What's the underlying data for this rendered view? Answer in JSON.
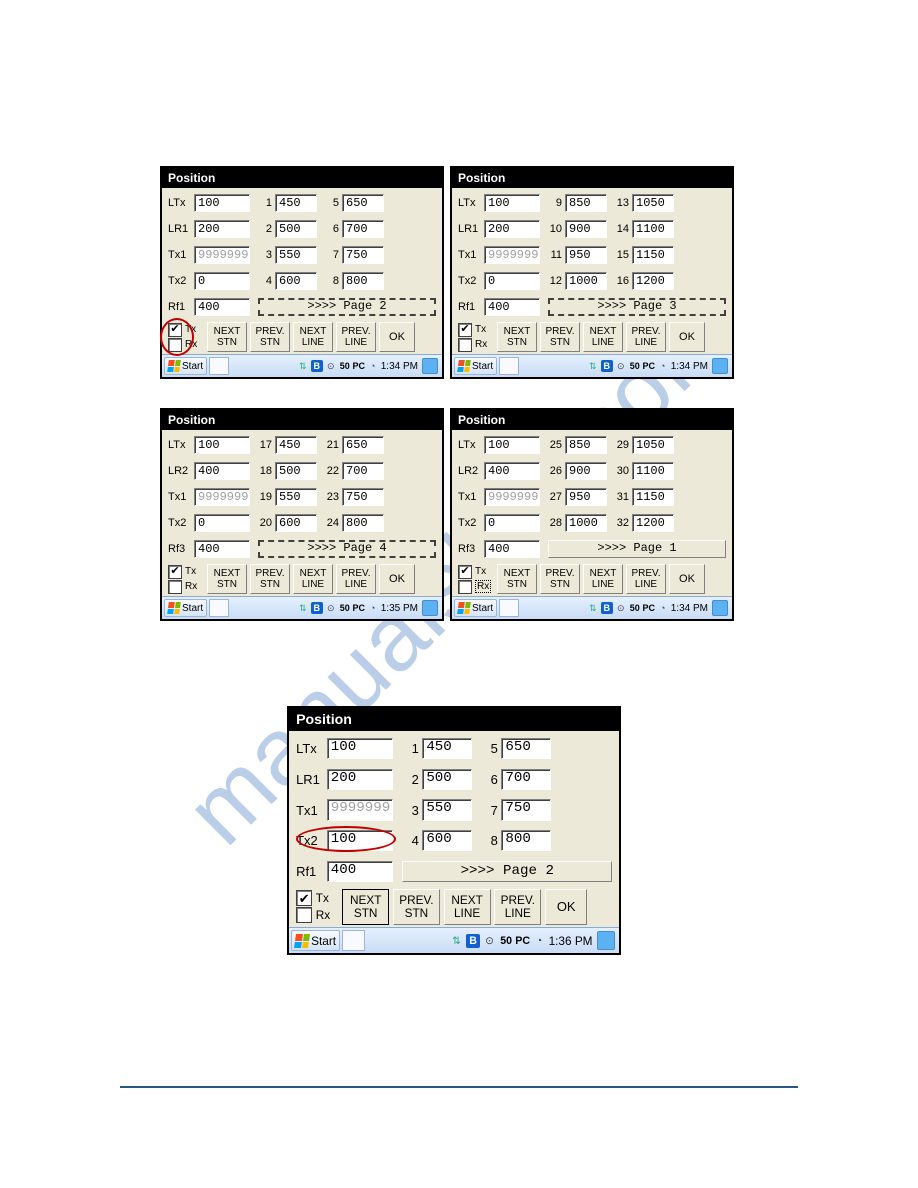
{
  "panels": [
    {
      "title": "Position",
      "leftRows": [
        {
          "label": "LTx",
          "value": "100"
        },
        {
          "label": "LR1",
          "value": "200"
        },
        {
          "label": "Tx1",
          "value": "9999999",
          "disabled": true
        },
        {
          "label": "Tx2",
          "value": "0"
        },
        {
          "label": "Rf1",
          "value": "400"
        }
      ],
      "gridCols": [
        [
          {
            "n": "1",
            "v": "450"
          },
          {
            "n": "2",
            "v": "500"
          },
          {
            "n": "3",
            "v": "550"
          },
          {
            "n": "4",
            "v": "600"
          }
        ],
        [
          {
            "n": "5",
            "v": "650"
          },
          {
            "n": "6",
            "v": "700"
          },
          {
            "n": "7",
            "v": "750"
          },
          {
            "n": "8",
            "v": "800"
          }
        ]
      ],
      "pageLabel": ">>>>  Page  2",
      "pageDashed": true,
      "tx": true,
      "rx": false,
      "buttons": [
        "NEXT\nSTN",
        "PREV.\nSTN",
        "NEXT\nLINE",
        "PREV.\nLINE"
      ],
      "okLabel": "OK",
      "time": "1:34 PM",
      "annot": "circle-left"
    },
    {
      "title": "Position",
      "leftRows": [
        {
          "label": "LTx",
          "value": "100"
        },
        {
          "label": "LR1",
          "value": "200"
        },
        {
          "label": "Tx1",
          "value": "9999999",
          "disabled": true
        },
        {
          "label": "Tx2",
          "value": "0"
        },
        {
          "label": "Rf1",
          "value": "400"
        }
      ],
      "gridCols": [
        [
          {
            "n": "9",
            "v": "850"
          },
          {
            "n": "10",
            "v": "900"
          },
          {
            "n": "11",
            "v": "950"
          },
          {
            "n": "12",
            "v": "1000"
          }
        ],
        [
          {
            "n": "13",
            "v": "1050"
          },
          {
            "n": "14",
            "v": "1100"
          },
          {
            "n": "15",
            "v": "1150"
          },
          {
            "n": "16",
            "v": "1200"
          }
        ]
      ],
      "pageLabel": ">>>>  Page  3",
      "pageDashed": true,
      "tx": true,
      "rx": false,
      "buttons": [
        "NEXT\nSTN",
        "PREV.\nSTN",
        "NEXT\nLINE",
        "PREV.\nLINE"
      ],
      "okLabel": "OK",
      "time": "1:34 PM"
    },
    {
      "title": "Position",
      "leftRows": [
        {
          "label": "LTx",
          "value": "100"
        },
        {
          "label": "LR2",
          "value": "400"
        },
        {
          "label": "Tx1",
          "value": "9999999",
          "disabled": true
        },
        {
          "label": "Tx2",
          "value": "0"
        },
        {
          "label": "Rf3",
          "value": "400"
        }
      ],
      "gridCols": [
        [
          {
            "n": "17",
            "v": "450"
          },
          {
            "n": "18",
            "v": "500"
          },
          {
            "n": "19",
            "v": "550"
          },
          {
            "n": "20",
            "v": "600"
          }
        ],
        [
          {
            "n": "21",
            "v": "650"
          },
          {
            "n": "22",
            "v": "700"
          },
          {
            "n": "23",
            "v": "750"
          },
          {
            "n": "24",
            "v": "800"
          }
        ]
      ],
      "pageLabel": ">>>>  Page  4",
      "pageDashed": true,
      "tx": true,
      "rx": false,
      "buttons": [
        "NEXT\nSTN",
        "PREV.\nSTN",
        "NEXT\nLINE",
        "PREV.\nLINE"
      ],
      "okLabel": "OK",
      "time": "1:35 PM"
    },
    {
      "title": "Position",
      "leftRows": [
        {
          "label": "LTx",
          "value": "100"
        },
        {
          "label": "LR2",
          "value": "400"
        },
        {
          "label": "Tx1",
          "value": "9999999",
          "disabled": true
        },
        {
          "label": "Tx2",
          "value": "0"
        },
        {
          "label": "Rf3",
          "value": "400"
        }
      ],
      "gridCols": [
        [
          {
            "n": "25",
            "v": "850"
          },
          {
            "n": "26",
            "v": "900"
          },
          {
            "n": "27",
            "v": "950"
          },
          {
            "n": "28",
            "v": "1000"
          }
        ],
        [
          {
            "n": "29",
            "v": "1050"
          },
          {
            "n": "30",
            "v": "1100"
          },
          {
            "n": "31",
            "v": "1150"
          },
          {
            "n": "32",
            "v": "1200"
          }
        ]
      ],
      "pageLabel": ">>>>  Page  1",
      "pageDashed": false,
      "tx": true,
      "rx": false,
      "rxBox": true,
      "buttons": [
        "NEXT\nSTN",
        "PREV.\nSTN",
        "NEXT\nLINE",
        "PREV.\nLINE"
      ],
      "okLabel": "OK",
      "time": "1:34 PM"
    },
    {
      "title": "Position",
      "leftRows": [
        {
          "label": "LTx",
          "value": "100"
        },
        {
          "label": "LR1",
          "value": "200"
        },
        {
          "label": "Tx1",
          "value": "9999999",
          "disabled": true
        },
        {
          "label": "Tx2",
          "value": "100"
        },
        {
          "label": "Rf1",
          "value": "400"
        }
      ],
      "gridCols": [
        [
          {
            "n": "1",
            "v": "450"
          },
          {
            "n": "2",
            "v": "500"
          },
          {
            "n": "3",
            "v": "550"
          },
          {
            "n": "4",
            "v": "600"
          }
        ],
        [
          {
            "n": "5",
            "v": "650"
          },
          {
            "n": "6",
            "v": "700"
          },
          {
            "n": "7",
            "v": "750"
          },
          {
            "n": "8",
            "v": "800"
          }
        ]
      ],
      "pageLabel": ">>>>  Page  2",
      "pageDashed": false,
      "tx": true,
      "rx": false,
      "buttons": [
        "NEXT\nSTN",
        "PREV.\nSTN",
        "NEXT\nLINE",
        "PREV.\nLINE"
      ],
      "hlButton": 0,
      "okLabel": "OK",
      "time": "1:36 PM",
      "annot": "ellipse-tx2"
    }
  ],
  "startLabel": "Start",
  "trayPC": "PC",
  "tray50": "50"
}
